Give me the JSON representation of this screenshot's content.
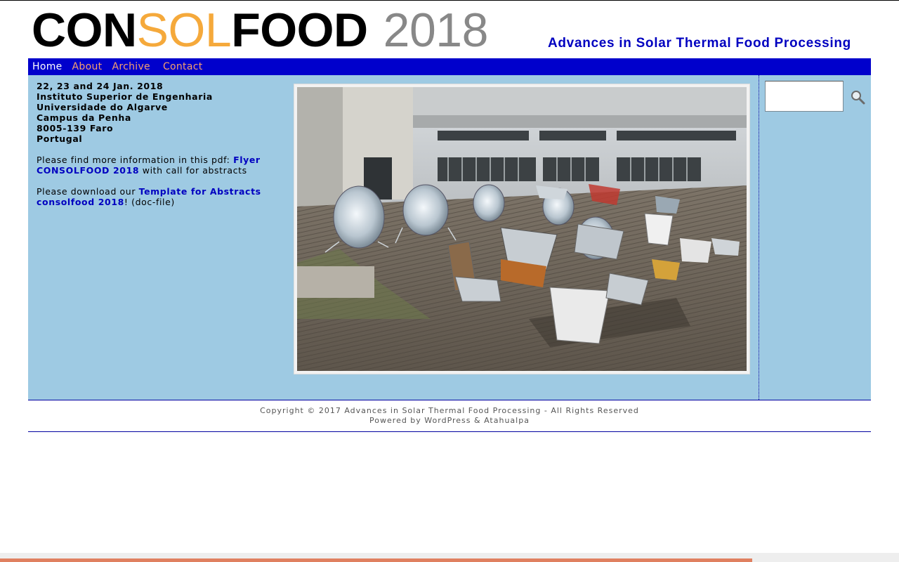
{
  "header": {
    "logo_parts": [
      "CON",
      "SOL",
      "FOOD",
      "2018"
    ],
    "tagline": "Advances in Solar Thermal Food Processing"
  },
  "nav": {
    "items": [
      "Home",
      "About",
      "Archive",
      "Contact"
    ],
    "active": "Home"
  },
  "content": {
    "address_lines": [
      "22, 23 and 24 Jan. 2018",
      "Instituto Superior de Engenharia",
      "Universidade do Algarve",
      "Campus da Penha",
      "8005-139 Faro",
      "Portugal"
    ],
    "flyer_prefix": "Please find more information in this pdf: ",
    "flyer_link": "Flyer CONSOLFOOD 2018",
    "flyer_suffix": " with call for abstracts",
    "template_prefix": "Please download our ",
    "template_link": "Template for Abstracts consolfood 2018",
    "template_suffix": "! (doc-file)"
  },
  "search": {
    "placeholder": ""
  },
  "footer": {
    "copyright": "Copyright © 2017 Advances in Solar Thermal Food Processing - All Rights Reserved",
    "powered": "Powered by WordPress & Atahualpa"
  },
  "colors": {
    "nav_bg": "#0000cc",
    "accent_orange": "#f5a93b",
    "link_blue": "#0000c0",
    "content_bg": "#9ecae3"
  },
  "icons": {
    "search": "magnifier-icon"
  }
}
